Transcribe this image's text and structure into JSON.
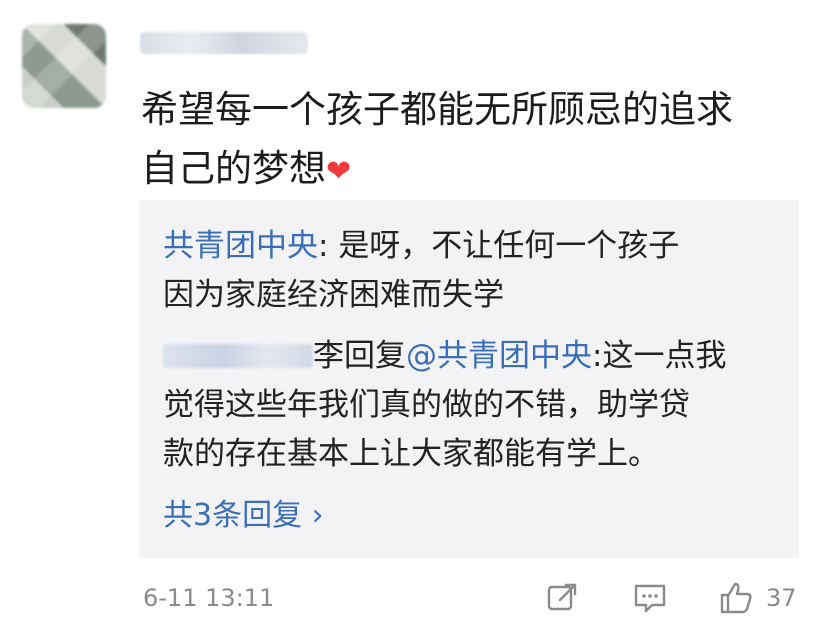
{
  "comment": {
    "line1": "希望每一个孩子都能无所顾忌的追求",
    "line2": "自己的梦想",
    "emoji": "❤"
  },
  "replies": {
    "r1_author": "共青团中央",
    "r1_sep": ": ",
    "r1_text_a": "是呀，不让任何一个孩子",
    "r1_text_b": "因为家庭经济困难而失学",
    "r2_suffix": "李回复",
    "r2_mention": "@共青团中央",
    "r2_text_a": ":这一点我",
    "r2_text_b": "觉得这些年我们真的做的不错，助学贷",
    "r2_text_c": "款的存在基本上让大家都能有学上。",
    "more": "共3条回复 ›"
  },
  "footer": {
    "time": "6-11 13:11",
    "share_icon": "share-icon",
    "comment_icon": "comment-icon",
    "like_icon": "thumbs-up-icon",
    "likes": "37"
  },
  "colors": {
    "link": "#3a6fb7",
    "meta": "#8a8a8a",
    "reply_bg": "#f3f3f5"
  }
}
